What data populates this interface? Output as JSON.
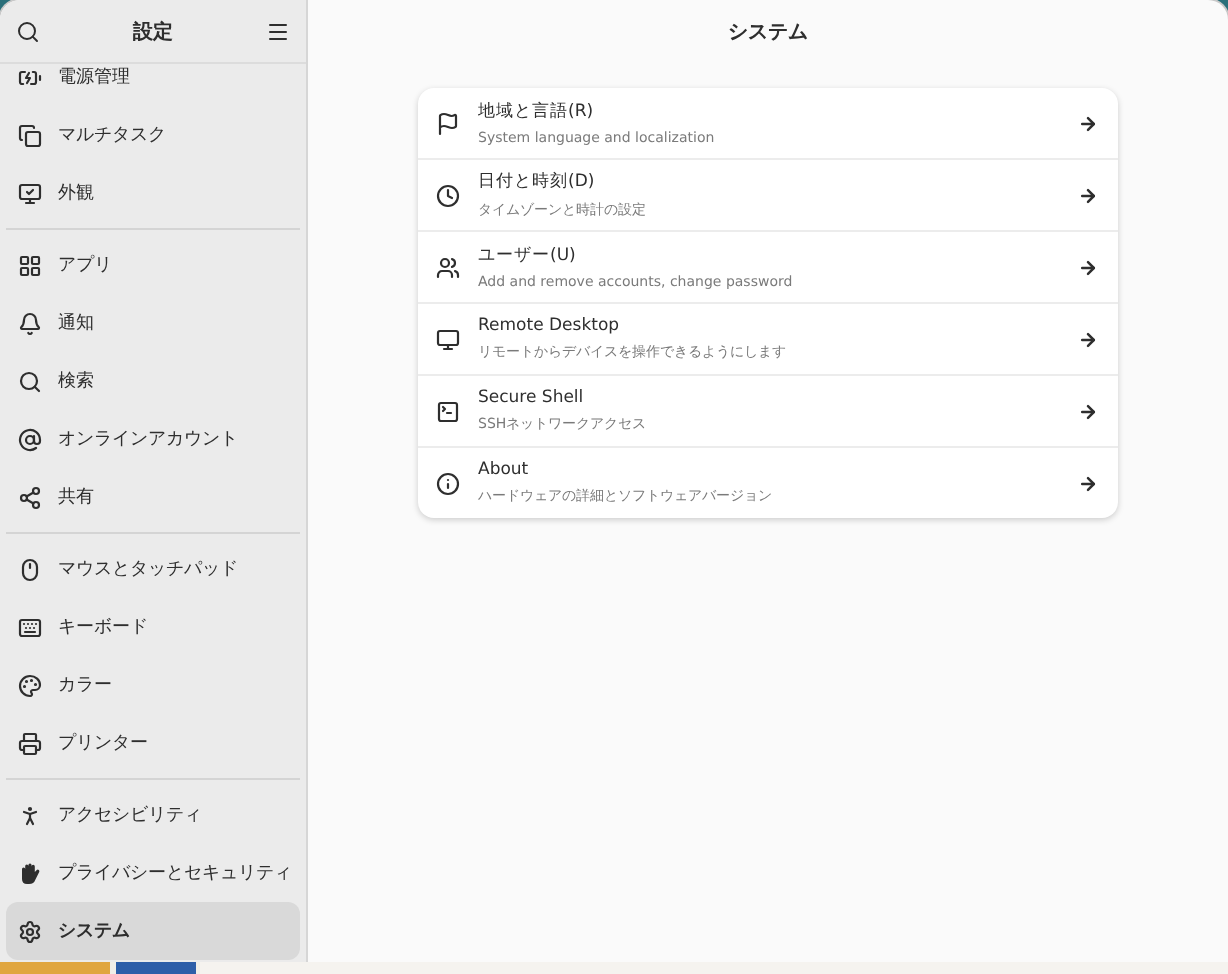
{
  "sidebar": {
    "title": "設定",
    "groups": [
      {
        "items": [
          {
            "label": "電源管理",
            "selected": false
          },
          {
            "label": "マルチタスク",
            "selected": false
          },
          {
            "label": "外観",
            "selected": false
          }
        ]
      },
      {
        "items": [
          {
            "label": "アプリ",
            "selected": false
          },
          {
            "label": "通知",
            "selected": false
          },
          {
            "label": "検索",
            "selected": false
          },
          {
            "label": "オンラインアカウント",
            "selected": false
          },
          {
            "label": "共有",
            "selected": false
          }
        ]
      },
      {
        "items": [
          {
            "label": "マウスとタッチパッド",
            "selected": false
          },
          {
            "label": "キーボード",
            "selected": false
          },
          {
            "label": "カラー",
            "selected": false
          },
          {
            "label": "プリンター",
            "selected": false
          }
        ]
      },
      {
        "items": [
          {
            "label": "アクセシビリティ",
            "selected": false
          },
          {
            "label": "プライバシーとセキュリティ",
            "selected": false
          },
          {
            "label": "システム",
            "selected": true
          }
        ]
      }
    ]
  },
  "main": {
    "title": "システム",
    "rows": [
      {
        "title": "地域と言語(R)",
        "subtitle": "System language and localization"
      },
      {
        "title": "日付と時刻(D)",
        "subtitle": "タイムゾーンと時計の設定"
      },
      {
        "title": "ユーザー(U)",
        "subtitle": "Add and remove accounts, change password"
      },
      {
        "title": "Remote Desktop",
        "subtitle": "リモートからデバイスを操作できるようにします"
      },
      {
        "title": "Secure Shell",
        "subtitle": "SSHネットワークアクセス"
      },
      {
        "title": "About",
        "subtitle": "ハードウェアの詳細とソフトウェアバージョン"
      }
    ]
  }
}
